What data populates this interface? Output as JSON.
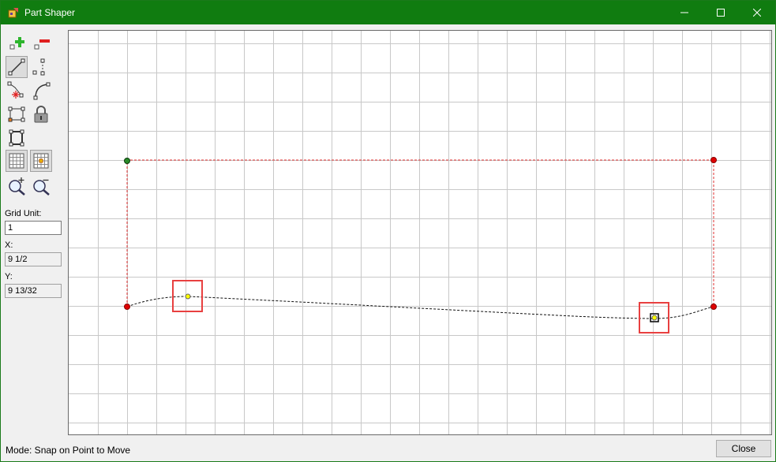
{
  "window": {
    "title": "Part Shaper"
  },
  "titlebar": {
    "minimize_glyph": "—",
    "maximize_glyph": "☐",
    "close_glyph": "✕"
  },
  "toolbox": {
    "tools": [
      {
        "name": "add-point",
        "icon": "plus-icon"
      },
      {
        "name": "remove-point",
        "icon": "minus-icon"
      },
      {
        "name": "line-segment",
        "icon": "line-icon"
      },
      {
        "name": "dimension-segment",
        "icon": "dashed-segment-icon"
      },
      {
        "name": "bevel-corner",
        "icon": "bevel-icon"
      },
      {
        "name": "curve-corner",
        "icon": "curve-icon"
      },
      {
        "name": "rectangle",
        "icon": "rectangle-icon"
      },
      {
        "name": "lock",
        "icon": "lock-icon"
      },
      {
        "name": "frame",
        "icon": "frame-icon"
      },
      {
        "name": "show-grid",
        "icon": "grid-icon"
      },
      {
        "name": "snap-grid",
        "icon": "snap-grid-icon"
      },
      {
        "name": "zoom-in",
        "icon": "zoom-in-icon"
      },
      {
        "name": "zoom-out",
        "icon": "zoom-out-icon"
      }
    ],
    "grid_unit_label": "Grid Unit:",
    "grid_unit_value": "1",
    "x_label": "X:",
    "x_value": "9 1/2",
    "y_label": "Y:",
    "y_value": "9 13/32"
  },
  "status": {
    "mode_text": "Mode: Snap on Point to Move"
  },
  "buttons": {
    "close_label": "Close"
  },
  "colors": {
    "titlebar": "#107c10",
    "grid": "#c8c8c8",
    "outline": "#e03030",
    "corner_point": "#e00000",
    "start_point": "#2a8a2a",
    "control_point": "#ffff00",
    "highlight_box": "#e84040"
  }
}
